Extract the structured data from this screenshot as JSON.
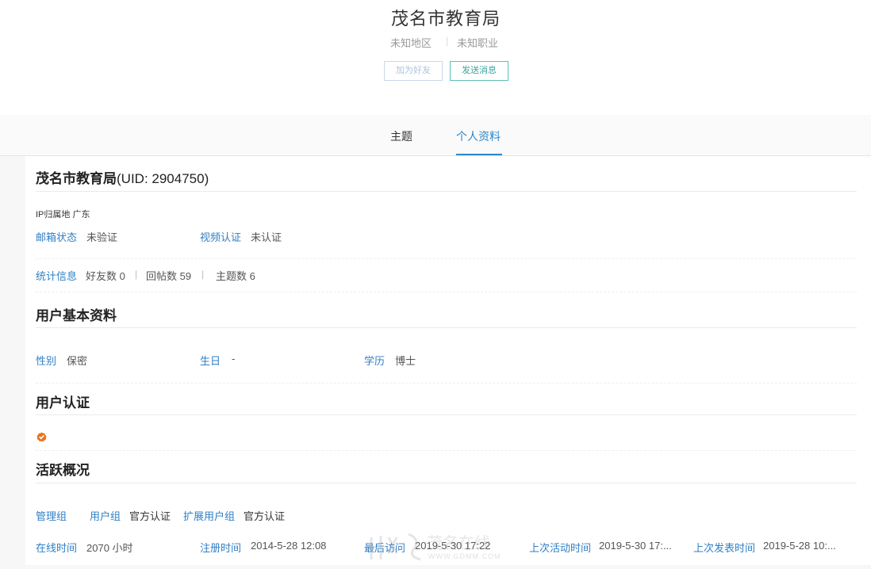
{
  "header": {
    "name": "茂名市教育局",
    "region": "未知地区",
    "separator": "|",
    "occupation": "未知职业",
    "add_friend": "加为好友",
    "send_message": "发送消息"
  },
  "tabs": [
    {
      "label": "主题",
      "active": false
    },
    {
      "label": "个人资料",
      "active": true
    }
  ],
  "profile": {
    "title_name": "茂名市教育局",
    "title_uid": "(UID: 2904750)",
    "ip_location": "IP归属地 广东",
    "email_label": "邮箱状态",
    "email_value": "未验证",
    "video_label": "视频认证",
    "video_value": "未认证",
    "stats_label": "统计信息",
    "friends": "好友数 0",
    "replies": "回帖数 59",
    "topics": "主题数 6",
    "pipe": "|"
  },
  "basic": {
    "heading": "用户基本资料",
    "gender_label": "性别",
    "gender_value": "保密",
    "birthday_label": "生日",
    "birthday_value": "-",
    "education_label": "学历",
    "education_value": "博士"
  },
  "verify": {
    "heading": "用户认证",
    "badge_icon": "verified-badge-icon",
    "badge_color": "#e8731e"
  },
  "activity": {
    "heading": "活跃概况",
    "admin_group_label": "管理组",
    "user_group_label": "用户组",
    "user_group_value": "官方认证",
    "ext_group_label": "扩展用户组",
    "ext_group_value": "官方认证",
    "online_label": "在线时间",
    "online_value": "2070 小时",
    "register_label": "注册时间",
    "register_value": "2014-5-28 12:08",
    "last_visit_label": "最后访问",
    "last_visit_value": "2019-5-30 17:22",
    "last_active_label": "上次活动时间",
    "last_active_value": "2019-5-30 17:...",
    "last_post_label": "上次发表时间",
    "last_post_value": "2019-5-28 10:..."
  },
  "watermark": {
    "url": "WWW.GDMM.COM"
  },
  "colors": {
    "link": "#2f7fc6",
    "active_tab": "#2f86c8",
    "teal_button": "#3aa5a0"
  }
}
